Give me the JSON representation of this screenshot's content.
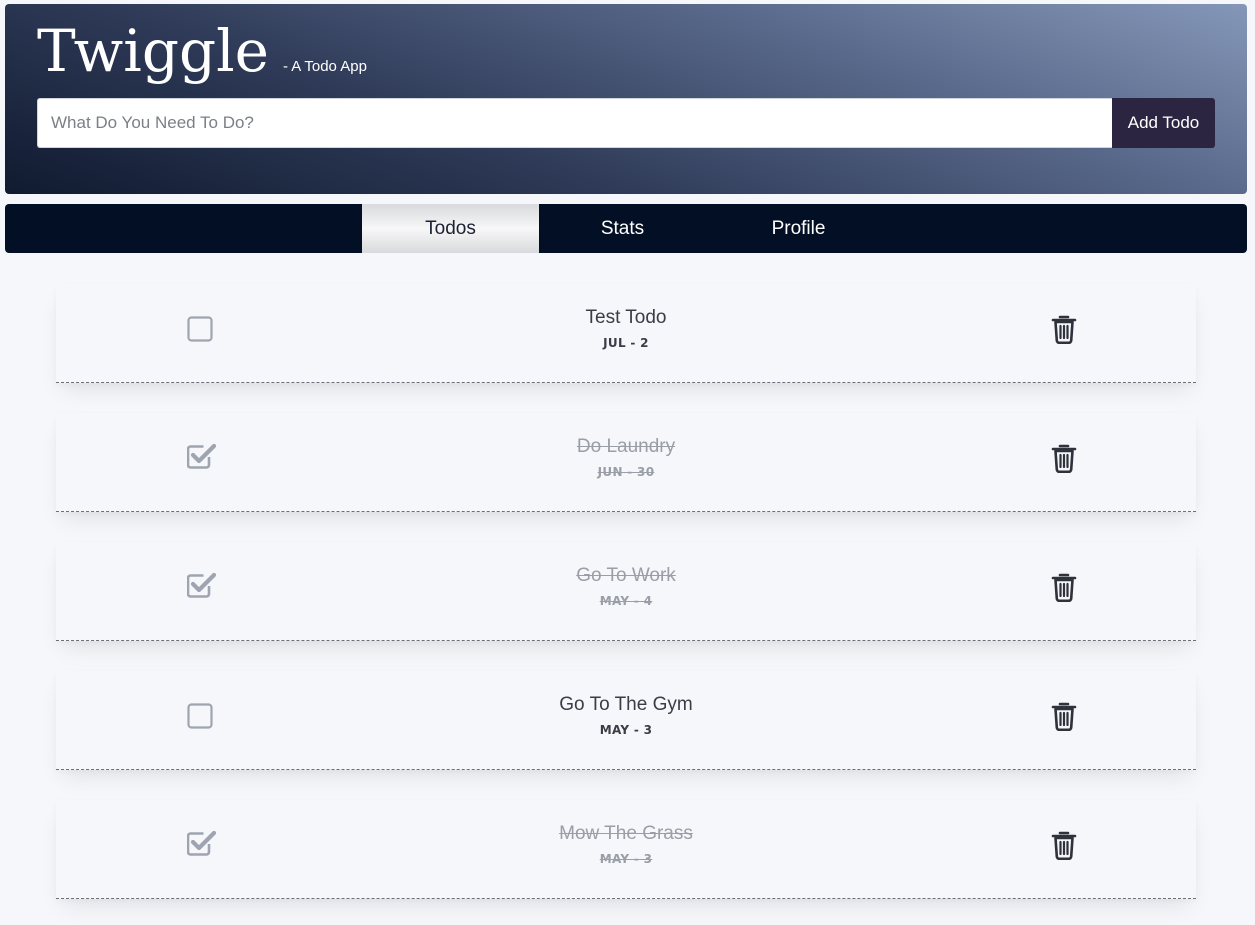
{
  "app": {
    "title": "Twiggle",
    "subtitle": "- A Todo App"
  },
  "add_form": {
    "placeholder": "What Do You Need To Do?",
    "value": "",
    "button_label": "Add Todo"
  },
  "tabs": [
    {
      "label": "Todos",
      "active": true
    },
    {
      "label": "Stats",
      "active": false
    },
    {
      "label": "Profile",
      "active": false
    }
  ],
  "todos": [
    {
      "title": "Test Todo",
      "date": "JUL - 2",
      "completed": false
    },
    {
      "title": "Do Laundry",
      "date": "JUN - 30",
      "completed": true
    },
    {
      "title": "Go To Work",
      "date": "MAY - 4",
      "completed": true
    },
    {
      "title": "Go To The Gym",
      "date": "MAY - 3",
      "completed": false
    },
    {
      "title": "Mow The Grass",
      "date": "MAY - 3",
      "completed": true
    }
  ],
  "icons": {
    "checkbox_empty": "square-outline-icon",
    "checkbox_checked": "check-square-icon",
    "delete": "trash-icon"
  },
  "colors": {
    "header_dark": "#101a30",
    "header_light": "#8597b8",
    "add_button": "#2b2541",
    "tabs_bar": "#030f24",
    "completed_text": "#9a9ea6",
    "checkbox": "#9fa5b0"
  }
}
